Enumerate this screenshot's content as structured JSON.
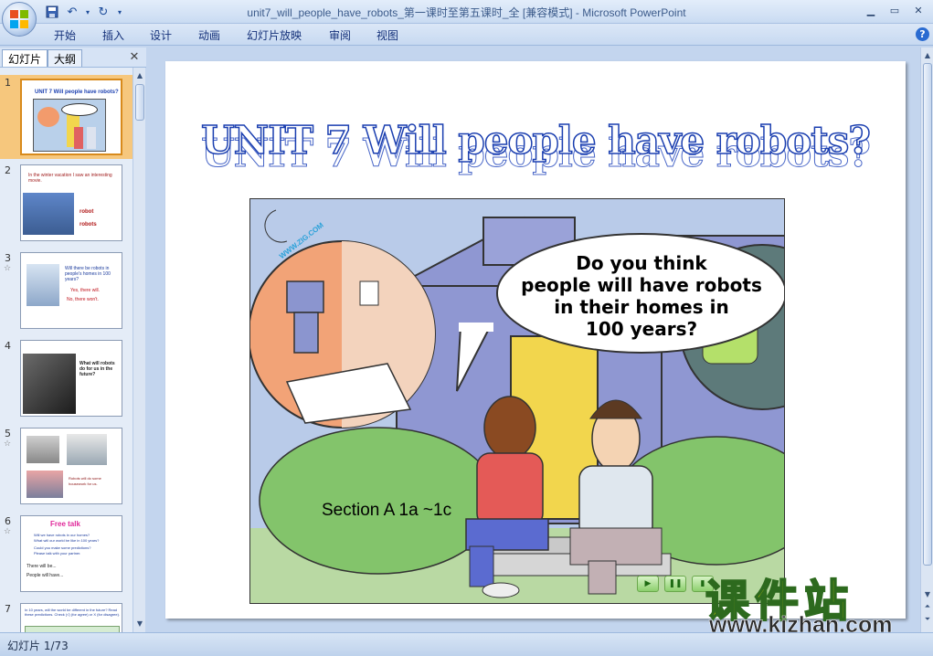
{
  "window": {
    "title": "unit7_will_people_have_robots_第一课时至第五课时_全 [兼容模式] - Microsoft PowerPoint"
  },
  "ribbon": {
    "tabs": [
      "开始",
      "插入",
      "设计",
      "动画",
      "幻灯片放映",
      "审阅",
      "视图"
    ]
  },
  "left_pane": {
    "tabs": [
      "幻灯片",
      "大纲"
    ],
    "slides": [
      {
        "number": "1",
        "title": "UNIT 7 Will people have robots?",
        "text": "Do you think people will have robots in their homes in 100 years?",
        "selected": true
      },
      {
        "number": "2",
        "text": "In the winter vacation I saw an interesting movie.",
        "labels": [
          "robot",
          "robots"
        ]
      },
      {
        "number": "3",
        "text": "Will there be robots in people's homes in 100 years?",
        "labels": [
          "Yes, there will.",
          "No, there won't."
        ]
      },
      {
        "number": "4",
        "text": "What will robots do for us in the future?"
      },
      {
        "number": "5",
        "text": "Robots will do some housework for us."
      },
      {
        "number": "6",
        "title": "Free talk",
        "lines": [
          "Will we have robots in our homes?",
          "What will our world be like in 100 years?",
          "Could you make some predictions?",
          "Please talk with your partner.",
          "There will be...",
          "People will have..."
        ]
      },
      {
        "number": "7",
        "text": "In 10 years, will the world be different in the future? Read these predictions. Check (√) (for agree) or X (for disagree)."
      }
    ]
  },
  "slide": {
    "title": "UNIT 7  Will people have robots?",
    "speech": [
      "Do you think",
      "people will have robots",
      "in their homes in",
      "100 years?"
    ],
    "section": "Section A 1a ~1c",
    "image_watermark": "WWW.ZIG.COM"
  },
  "branding": {
    "logo_cn": "课件站",
    "logo_url": "www.kjzhan.com"
  },
  "status_bar": {
    "text": "幻灯片 1/73"
  }
}
